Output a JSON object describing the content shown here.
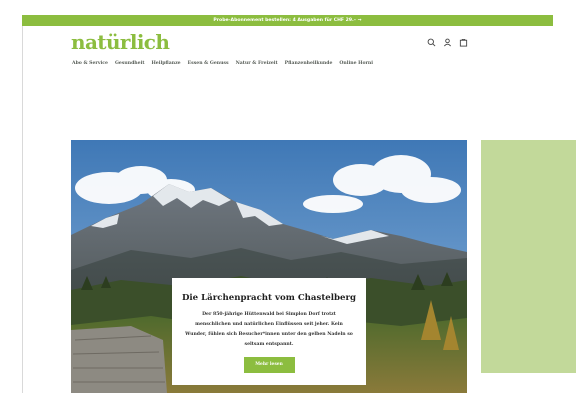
{
  "announcement": {
    "text": "Probe-Abonnement bestellen: 4 Ausgaben für CHF 29.– →"
  },
  "header": {
    "logo": "natürlich",
    "icons": [
      "search-icon",
      "account-icon",
      "cart-icon"
    ]
  },
  "nav": {
    "items": [
      "Abo & Service",
      "Gesundheit",
      "Heilpflanze",
      "Essen & Genuss",
      "Natur & Freizeit",
      "Pflanzenheilkunde",
      "Online Horni"
    ]
  },
  "hero": {
    "title": "Die Lärchenpracht vom Chastelberg",
    "body": "Der 850-jährige Hüttenwald bei Simplon Dorf trotzt menschlichen und natürlichen Einflüssen seit jeher. Kein Wunder, fühlen sich Besucher*innen unter den gelben Nadeln so seltsam entspannt.",
    "button_label": "Mehr lesen"
  },
  "colors": {
    "accent": "#8cbd3f",
    "side_panel": "#c2d99a",
    "sky": "#4f87c0"
  }
}
